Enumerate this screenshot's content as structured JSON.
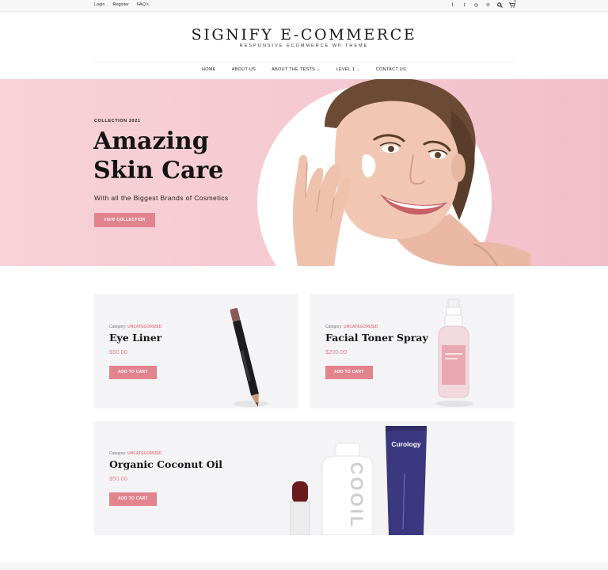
{
  "topbar": {
    "links": [
      "Login",
      "Register",
      "FAQ's"
    ],
    "icons": [
      "facebook-icon",
      "twitter-icon",
      "instagram-icon",
      "pinterest-icon",
      "search-icon",
      "cart-icon"
    ],
    "social_glyphs": [
      "f",
      "t",
      "◎",
      "℗"
    ],
    "cart_count": "0"
  },
  "brand": {
    "title": "SIGNIFY E-COMMERCE",
    "tagline": "RESPONSIVE ECOMMERCE WP THEME"
  },
  "nav": {
    "items": [
      "HOME",
      "ABOUT US",
      "ABOUT THE TESTS",
      "LEVEL 1",
      "CONTACT US"
    ],
    "chevron": "⌄"
  },
  "hero": {
    "eyebrow": "COLLECTION 2021",
    "title": "Amazing Skin Care",
    "subtitle": "With all the Biggest Brands of Cosmetics",
    "button": "VIEW COLLECTION"
  },
  "products": [
    {
      "category_label": "Category:",
      "category": "UNCATEGORIZED",
      "name": "Eye Liner",
      "price": "$50.00",
      "button": "ADD TO CART"
    },
    {
      "category_label": "Category:",
      "category": "UNCATEGORIZED",
      "name": "Facial Toner Spray",
      "price": "$200.00",
      "button": "ADD TO CART"
    },
    {
      "category_label": "Category:",
      "category": "UNCATEGORIZED",
      "name": "Organic Coconut Oil",
      "price": "$50.00",
      "button": "ADD TO CART"
    }
  ],
  "product_images": {
    "tube_brand": "Curology",
    "bottle_text": "COOIL"
  },
  "colors": {
    "accent": "#e2838d",
    "hero_bg": "#f5c9d1",
    "card_bg": "#f4f4f6"
  }
}
